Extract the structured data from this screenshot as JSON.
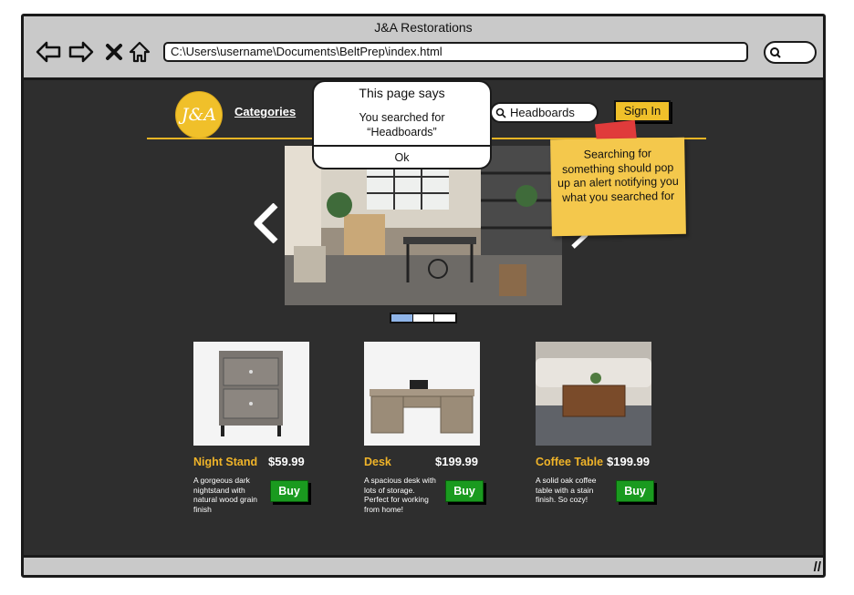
{
  "window": {
    "title": "J&A Restorations",
    "address": "C:\\Users\\username\\Documents\\BeltPrep\\index.html"
  },
  "icons": {
    "back": "back-arrow-icon",
    "forward": "forward-arrow-icon",
    "stop": "close-icon",
    "home": "home-icon",
    "search": "search-icon"
  },
  "site": {
    "logo_text": "J&A",
    "nav": {
      "categories": "Categories"
    },
    "search": {
      "value": "Headboards"
    },
    "sign_in": "Sign In"
  },
  "dialog": {
    "title": "This page says",
    "message_line1": "You searched for",
    "message_line2": "“Headboards”",
    "ok": "Ok"
  },
  "note": {
    "text": "Searching for something should pop up an alert notifying you what you searched for"
  },
  "carousel": {
    "slide_count": 3,
    "active_slide": 1
  },
  "products": [
    {
      "name": "Night Stand",
      "price": "$59.99",
      "description": "A gorgeous dark nightstand with natural wood grain finish",
      "buy": "Buy"
    },
    {
      "name": "Desk",
      "price": "$199.99",
      "description": "A spacious desk with lots of storage. Perfect for working from home!",
      "buy": "Buy"
    },
    {
      "name": "Coffee Table",
      "price": "$199.99",
      "description": "A solid oak coffee table with a stain finish. So cozy!",
      "buy": "Buy"
    }
  ],
  "colors": {
    "accent": "#f0c02a",
    "background": "#2e2e2e",
    "buy_button": "#1a9a1f",
    "product_name": "#f0b429",
    "note": "#f4c84c",
    "active_dot": "#8fb4e8"
  }
}
